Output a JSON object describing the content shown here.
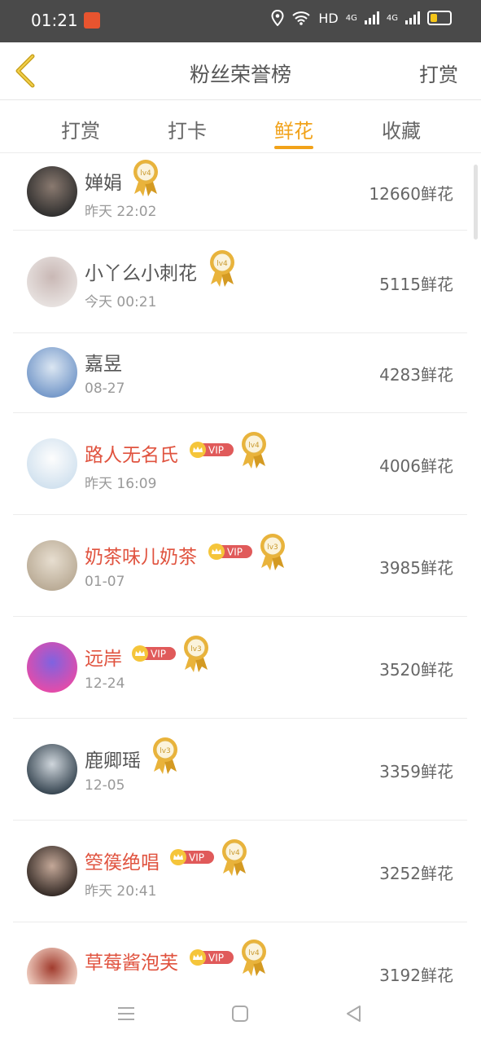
{
  "status_bar": {
    "time": "01:21",
    "network_text": "HD",
    "sig1": "4G",
    "sig2": "4G"
  },
  "header": {
    "title": "粉丝荣誉榜",
    "action": "打赏"
  },
  "tabs": [
    {
      "label": "打赏"
    },
    {
      "label": "打卡"
    },
    {
      "label": "鲜花",
      "active": true
    },
    {
      "label": "收藏"
    }
  ],
  "vip_label": "VIP",
  "rows": [
    {
      "name": "婵娟",
      "date": "昨天 22:02",
      "amount": "12660鲜花",
      "vip": false,
      "level": "lv4"
    },
    {
      "name": "小丫么小刺花",
      "date": "今天 00:21",
      "amount": "5115鲜花",
      "vip": false,
      "level": "lv4"
    },
    {
      "name": "嘉昱",
      "date": "08-27",
      "amount": "4283鲜花",
      "vip": false,
      "level": ""
    },
    {
      "name": "路人无名氏",
      "date": "昨天 16:09",
      "amount": "4006鲜花",
      "vip": true,
      "level": "lv4"
    },
    {
      "name": "奶茶味儿奶茶",
      "date": "01-07",
      "amount": "3985鲜花",
      "vip": true,
      "level": "lv3"
    },
    {
      "name": "远岸",
      "date": "12-24",
      "amount": "3520鲜花",
      "vip": true,
      "level": "lv3"
    },
    {
      "name": "鹿卿瑶",
      "date": "12-05",
      "amount": "3359鲜花",
      "vip": false,
      "level": "lv3"
    },
    {
      "name": "箜篌绝唱",
      "date": "昨天 20:41",
      "amount": "3252鲜花",
      "vip": true,
      "level": "lv4"
    },
    {
      "name": "草莓酱泡芙",
      "date": "",
      "amount": "3192鲜花",
      "vip": true,
      "level": "lv4"
    }
  ],
  "colors": {
    "accent": "#f1a21a",
    "vip_name": "#e0533f",
    "vip_badge": "#e05a5a",
    "medal_gold": "#e9b33b"
  }
}
